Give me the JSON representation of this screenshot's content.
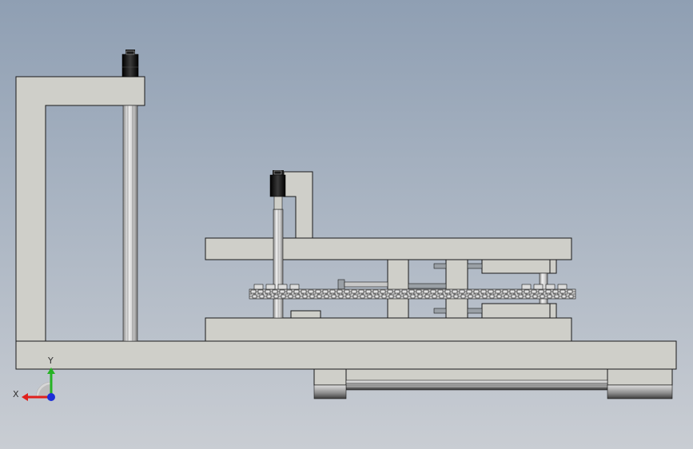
{
  "viewport": {
    "background_top": "#8f9fb3",
    "background_bottom": "#c9cdd3"
  },
  "colors": {
    "part_fill": "#cfcfc9",
    "part_stroke": "#1a1a1a",
    "rod_light": "#f2f2f2",
    "rod_dark": "#8c8c8c",
    "cylinder": "#151515",
    "rail_light": "#e6e6e6",
    "rail_dark": "#5a5a5a"
  },
  "triad": {
    "x_label": "X",
    "y_label": "Y",
    "x_color": "#e0201c",
    "y_color": "#25b324",
    "z_color": "#1d2fd8"
  }
}
